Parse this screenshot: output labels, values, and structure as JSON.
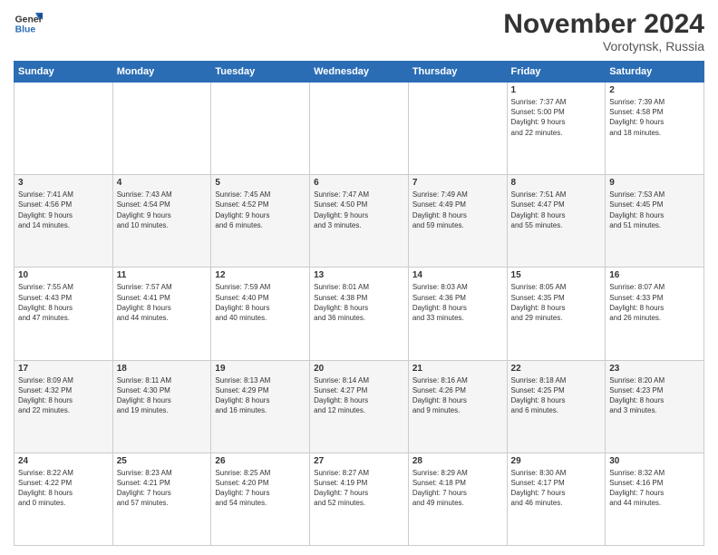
{
  "logo": {
    "text_general": "General",
    "text_blue": "Blue"
  },
  "header": {
    "title": "November 2024",
    "subtitle": "Vorotynsk, Russia"
  },
  "weekdays": [
    "Sunday",
    "Monday",
    "Tuesday",
    "Wednesday",
    "Thursday",
    "Friday",
    "Saturday"
  ],
  "weeks": [
    [
      {
        "day": "",
        "info": ""
      },
      {
        "day": "",
        "info": ""
      },
      {
        "day": "",
        "info": ""
      },
      {
        "day": "",
        "info": ""
      },
      {
        "day": "",
        "info": ""
      },
      {
        "day": "1",
        "info": "Sunrise: 7:37 AM\nSunset: 5:00 PM\nDaylight: 9 hours\nand 22 minutes."
      },
      {
        "day": "2",
        "info": "Sunrise: 7:39 AM\nSunset: 4:58 PM\nDaylight: 9 hours\nand 18 minutes."
      }
    ],
    [
      {
        "day": "3",
        "info": "Sunrise: 7:41 AM\nSunset: 4:56 PM\nDaylight: 9 hours\nand 14 minutes."
      },
      {
        "day": "4",
        "info": "Sunrise: 7:43 AM\nSunset: 4:54 PM\nDaylight: 9 hours\nand 10 minutes."
      },
      {
        "day": "5",
        "info": "Sunrise: 7:45 AM\nSunset: 4:52 PM\nDaylight: 9 hours\nand 6 minutes."
      },
      {
        "day": "6",
        "info": "Sunrise: 7:47 AM\nSunset: 4:50 PM\nDaylight: 9 hours\nand 3 minutes."
      },
      {
        "day": "7",
        "info": "Sunrise: 7:49 AM\nSunset: 4:49 PM\nDaylight: 8 hours\nand 59 minutes."
      },
      {
        "day": "8",
        "info": "Sunrise: 7:51 AM\nSunset: 4:47 PM\nDaylight: 8 hours\nand 55 minutes."
      },
      {
        "day": "9",
        "info": "Sunrise: 7:53 AM\nSunset: 4:45 PM\nDaylight: 8 hours\nand 51 minutes."
      }
    ],
    [
      {
        "day": "10",
        "info": "Sunrise: 7:55 AM\nSunset: 4:43 PM\nDaylight: 8 hours\nand 47 minutes."
      },
      {
        "day": "11",
        "info": "Sunrise: 7:57 AM\nSunset: 4:41 PM\nDaylight: 8 hours\nand 44 minutes."
      },
      {
        "day": "12",
        "info": "Sunrise: 7:59 AM\nSunset: 4:40 PM\nDaylight: 8 hours\nand 40 minutes."
      },
      {
        "day": "13",
        "info": "Sunrise: 8:01 AM\nSunset: 4:38 PM\nDaylight: 8 hours\nand 36 minutes."
      },
      {
        "day": "14",
        "info": "Sunrise: 8:03 AM\nSunset: 4:36 PM\nDaylight: 8 hours\nand 33 minutes."
      },
      {
        "day": "15",
        "info": "Sunrise: 8:05 AM\nSunset: 4:35 PM\nDaylight: 8 hours\nand 29 minutes."
      },
      {
        "day": "16",
        "info": "Sunrise: 8:07 AM\nSunset: 4:33 PM\nDaylight: 8 hours\nand 26 minutes."
      }
    ],
    [
      {
        "day": "17",
        "info": "Sunrise: 8:09 AM\nSunset: 4:32 PM\nDaylight: 8 hours\nand 22 minutes."
      },
      {
        "day": "18",
        "info": "Sunrise: 8:11 AM\nSunset: 4:30 PM\nDaylight: 8 hours\nand 19 minutes."
      },
      {
        "day": "19",
        "info": "Sunrise: 8:13 AM\nSunset: 4:29 PM\nDaylight: 8 hours\nand 16 minutes."
      },
      {
        "day": "20",
        "info": "Sunrise: 8:14 AM\nSunset: 4:27 PM\nDaylight: 8 hours\nand 12 minutes."
      },
      {
        "day": "21",
        "info": "Sunrise: 8:16 AM\nSunset: 4:26 PM\nDaylight: 8 hours\nand 9 minutes."
      },
      {
        "day": "22",
        "info": "Sunrise: 8:18 AM\nSunset: 4:25 PM\nDaylight: 8 hours\nand 6 minutes."
      },
      {
        "day": "23",
        "info": "Sunrise: 8:20 AM\nSunset: 4:23 PM\nDaylight: 8 hours\nand 3 minutes."
      }
    ],
    [
      {
        "day": "24",
        "info": "Sunrise: 8:22 AM\nSunset: 4:22 PM\nDaylight: 8 hours\nand 0 minutes."
      },
      {
        "day": "25",
        "info": "Sunrise: 8:23 AM\nSunset: 4:21 PM\nDaylight: 7 hours\nand 57 minutes."
      },
      {
        "day": "26",
        "info": "Sunrise: 8:25 AM\nSunset: 4:20 PM\nDaylight: 7 hours\nand 54 minutes."
      },
      {
        "day": "27",
        "info": "Sunrise: 8:27 AM\nSunset: 4:19 PM\nDaylight: 7 hours\nand 52 minutes."
      },
      {
        "day": "28",
        "info": "Sunrise: 8:29 AM\nSunset: 4:18 PM\nDaylight: 7 hours\nand 49 minutes."
      },
      {
        "day": "29",
        "info": "Sunrise: 8:30 AM\nSunset: 4:17 PM\nDaylight: 7 hours\nand 46 minutes."
      },
      {
        "day": "30",
        "info": "Sunrise: 8:32 AM\nSunset: 4:16 PM\nDaylight: 7 hours\nand 44 minutes."
      }
    ]
  ]
}
